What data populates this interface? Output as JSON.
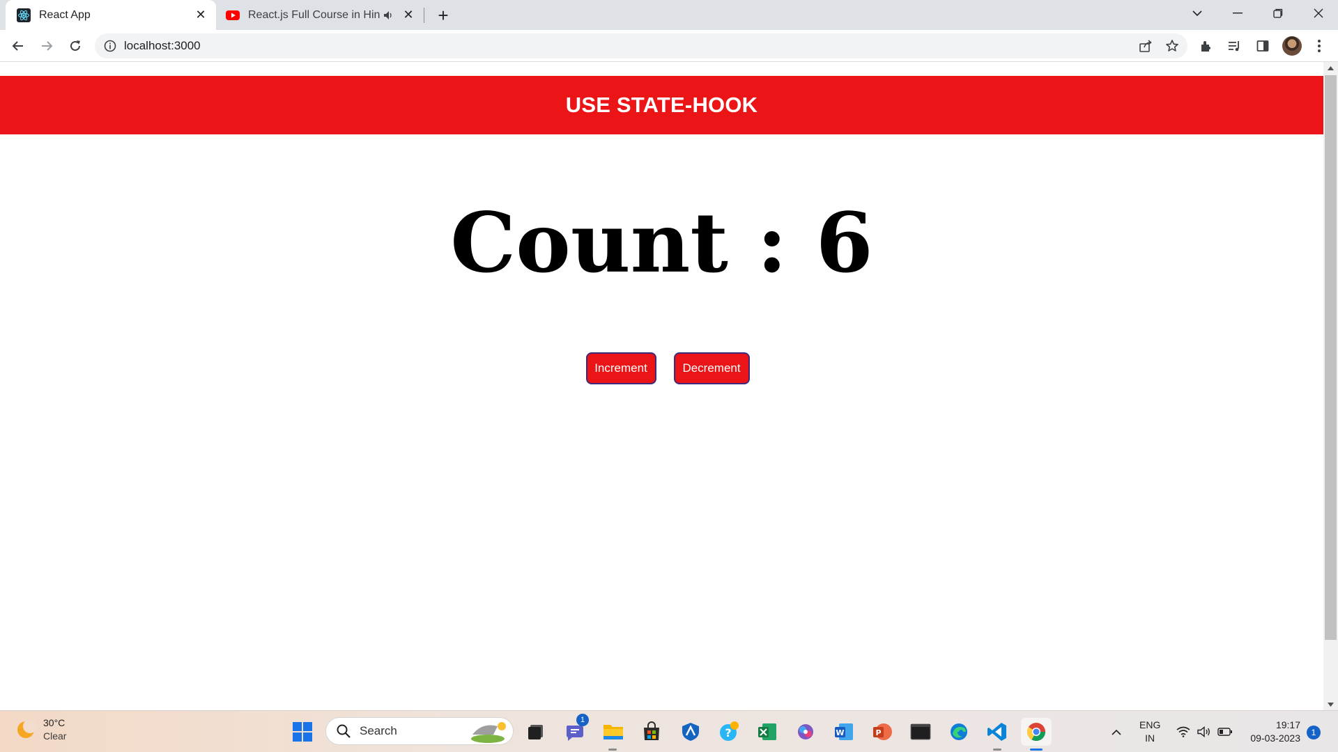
{
  "browser": {
    "tabs": [
      {
        "title": "React App",
        "active": true,
        "favicon": "react-icon"
      },
      {
        "title": "React.js Full Course in Hindi",
        "active": false,
        "favicon": "youtube-icon"
      }
    ],
    "address_bar": {
      "url": "localhost:3000"
    }
  },
  "page": {
    "header_title": "USE STATE-HOOK",
    "count_label": "Count : 6",
    "buttons": {
      "increment": "Increment",
      "decrement": "Decrement"
    }
  },
  "taskbar": {
    "weather": {
      "temp": "30°C",
      "condition": "Clear"
    },
    "search_placeholder": "Search",
    "teams_badge": "1",
    "language": {
      "line1": "ENG",
      "line2": "IN"
    },
    "clock": {
      "time": "19:17",
      "date": "09-03-2023"
    },
    "notifications": "1"
  },
  "colors": {
    "header_red": "#eb1416",
    "button_border": "#3b2b7a"
  }
}
